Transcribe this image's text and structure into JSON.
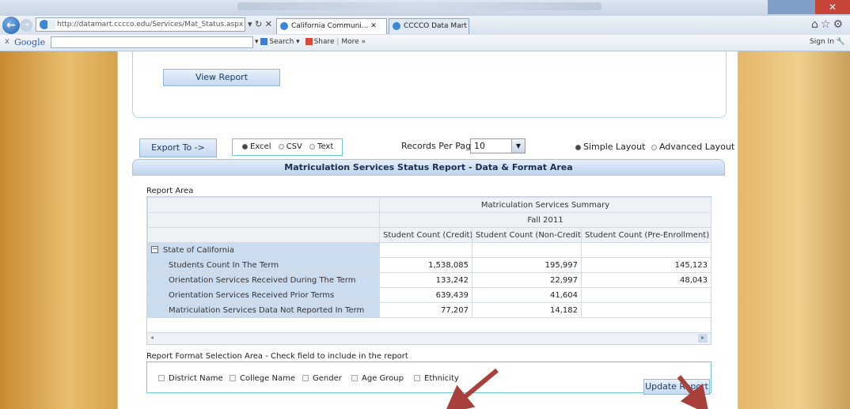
{
  "browser": {
    "address": "http://datamart.cccco.edu/Services/Mat_Status.aspx",
    "tabs": [
      "California Communi...",
      "CCCCO Data Mart - Stu..."
    ],
    "google_label": "Google",
    "google_search": "Search",
    "google_share": "Share",
    "google_more": "More »",
    "sign_in": "Sign In"
  },
  "controls": {
    "view_report": "View Report",
    "export_to": "Export To ->",
    "export_options": [
      "Excel",
      "CSV",
      "Text"
    ],
    "export_selected": "Excel",
    "records_per_page_label": "Records Per Page:",
    "records_per_page_value": "10",
    "layout_options": [
      "Simple Layout",
      "Advanced Layout"
    ],
    "layout_selected": "Simple Layout"
  },
  "report": {
    "section_title": "Matriculation Services Status Report - Data & Format Area",
    "area_label": "Report Area",
    "summary_title": "Matriculation Services Summary",
    "term": "Fall 2011",
    "columns": [
      "Student Count (Credit)",
      "Student Count (Non-Credit)",
      "Student Count (Pre-Enrollment)"
    ],
    "group": "State of California",
    "rows": [
      {
        "label": "Students Count In The Term",
        "values": [
          "1,538,085",
          "195,997",
          "145,123"
        ]
      },
      {
        "label": "Orientation Services Received During The Term",
        "values": [
          "133,242",
          "22,997",
          "48,043"
        ]
      },
      {
        "label": "Orientation Services Received Prior Terms",
        "values": [
          "639,439",
          "41,604",
          ""
        ]
      },
      {
        "label": "Matriculation Services Data Not Reported In Term",
        "values": [
          "77,207",
          "14,182",
          ""
        ]
      }
    ]
  },
  "format": {
    "label": "Report Format Selection Area - Check field to include in the report",
    "fields": [
      "District Name",
      "College Name",
      "Gender",
      "Age Group",
      "Ethnicity"
    ],
    "update_button": "Update Report"
  },
  "colors": {
    "accent": "#c5d9f1",
    "arrow": "#a8413c",
    "page_bg": "#d9a44a"
  }
}
